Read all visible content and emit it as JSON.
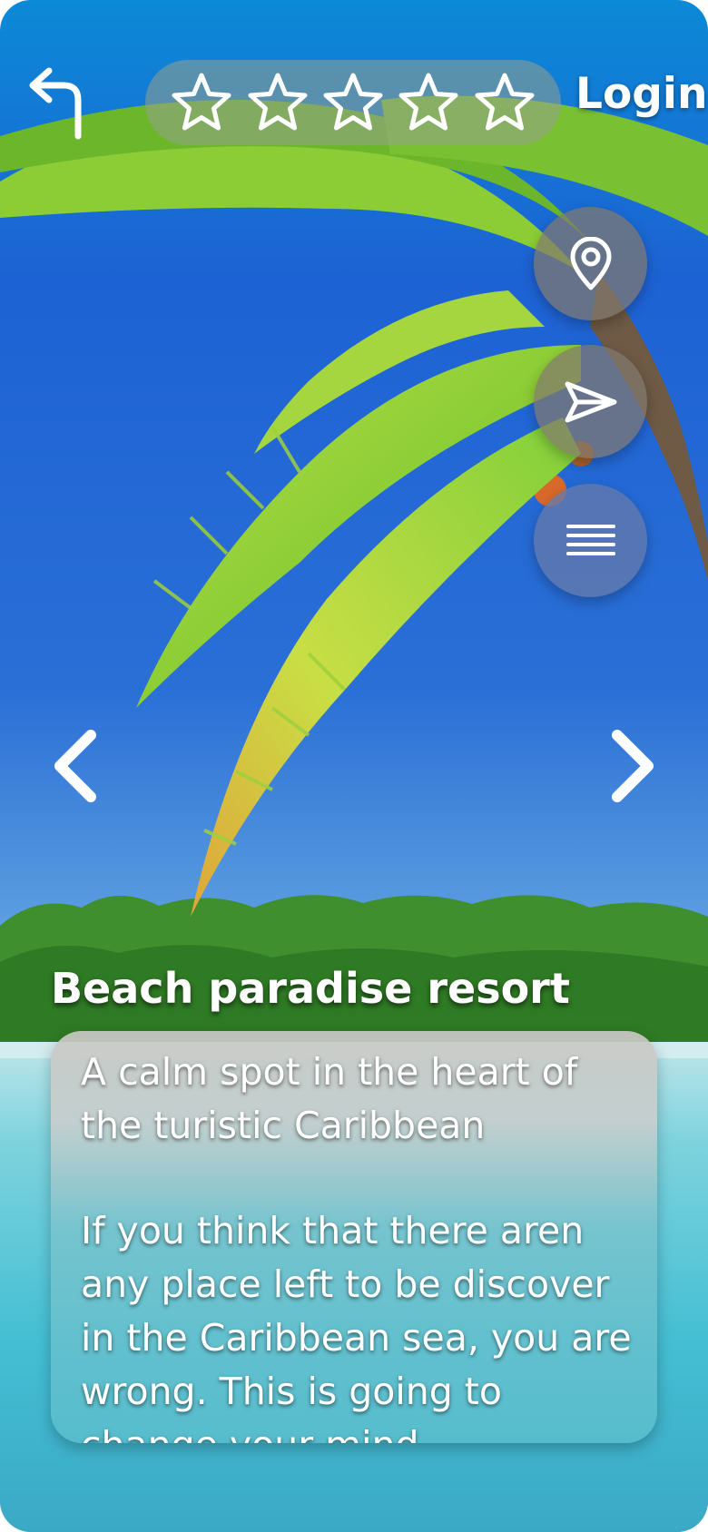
{
  "header": {
    "back_icon": "back-arrow-icon",
    "rating": {
      "stars_total": 5,
      "stars_filled": 0,
      "icon": "star-outline-icon"
    },
    "login_label": "Login"
  },
  "actions": [
    {
      "name": "location",
      "icon": "map-pin-icon"
    },
    {
      "name": "share",
      "icon": "send-icon"
    },
    {
      "name": "menu",
      "icon": "menu-icon"
    }
  ],
  "carousel": {
    "prev_icon": "chevron-left-icon",
    "next_icon": "chevron-right-icon"
  },
  "content": {
    "title": "Beach paradise resort",
    "lead": "A calm spot in the heart of the turistic Caribbean",
    "body": "If you think that there aren any place left to be discover in the Caribbean sea, you are wrong. This is going to change your mind."
  },
  "colors": {
    "sky": "#1e5fd0",
    "sea": "#4fc8d6",
    "palm": "#8cc83a",
    "text": "#ffffff"
  }
}
